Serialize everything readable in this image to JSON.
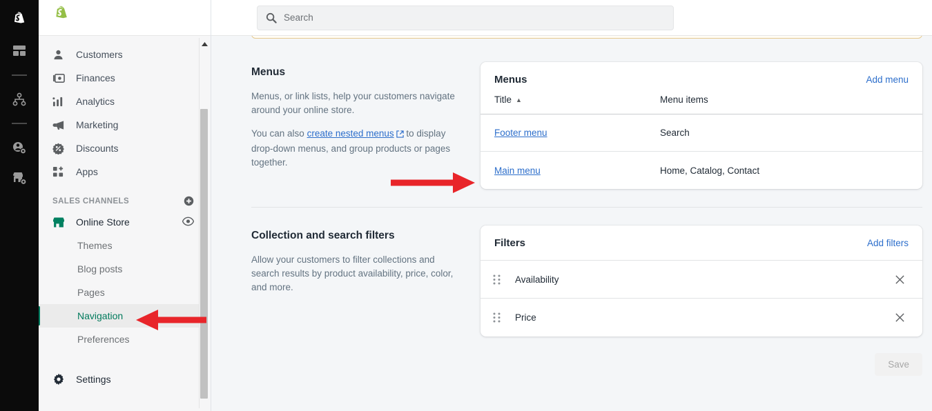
{
  "app": {
    "logo_icon": "shopify-bag-logo",
    "rail_items": [
      {
        "icon": "shopify-bag-logo",
        "name": "shopify-logo"
      },
      {
        "icon": "dashboard-grid-icon",
        "name": "dashboard"
      },
      {
        "icon": "divider",
        "name": "divider-1"
      },
      {
        "icon": "sitemap-hierarchy-icon",
        "name": "organization"
      },
      {
        "icon": "divider",
        "name": "divider-2"
      },
      {
        "icon": "user-settings-icon",
        "name": "user-settings"
      },
      {
        "icon": "store-settings-icon",
        "name": "store-settings"
      }
    ]
  },
  "search": {
    "placeholder": "Search",
    "value": "",
    "icon": "search-icon"
  },
  "sidebar": {
    "nav_items": [
      {
        "label": "Customers",
        "icon": "customers-icon"
      },
      {
        "label": "Finances",
        "icon": "finances-icon"
      },
      {
        "label": "Analytics",
        "icon": "analytics-icon"
      },
      {
        "label": "Marketing",
        "icon": "marketing-megaphone-icon"
      },
      {
        "label": "Discounts",
        "icon": "discounts-tag-icon"
      },
      {
        "label": "Apps",
        "icon": "apps-grid-plus-icon"
      }
    ],
    "sales_channels_label": "SALES CHANNELS",
    "add_channel_icon": "plus-circle-icon",
    "online_store": {
      "label": "Online Store",
      "icon": "storefront-icon",
      "icon_color": "#008060",
      "view_icon": "eye-icon"
    },
    "sub_items": [
      {
        "label": "Themes",
        "active": false
      },
      {
        "label": "Blog posts",
        "active": false
      },
      {
        "label": "Pages",
        "active": false
      },
      {
        "label": "Navigation",
        "active": true
      },
      {
        "label": "Preferences",
        "active": false
      }
    ],
    "settings": {
      "label": "Settings",
      "icon": "gear-icon"
    },
    "active_accent_color": "#00795c",
    "scrollbar": {
      "up_arrow_icon": "caret-up-icon"
    }
  },
  "main": {
    "menus_section": {
      "title": "Menus",
      "paragraph_1": "Menus, or link lists, help your customers navigate around your online store.",
      "paragraph_2_before": "You can also ",
      "link_text": "create nested menus",
      "link_icon": "external-link-icon",
      "paragraph_2_after": " to display drop-down menus, and group products or pages together.",
      "card": {
        "title": "Menus",
        "action_label": "Add menu",
        "columns": [
          "Title",
          "Menu items"
        ],
        "sort_indicator": "▲",
        "rows": [
          {
            "title": "Footer menu",
            "items": "Search"
          },
          {
            "title": "Main menu",
            "items": "Home, Catalog, Contact"
          }
        ]
      }
    },
    "filters_section": {
      "title": "Collection and search filters",
      "paragraph": "Allow your customers to filter collections and search results by product availability, price, color, and more.",
      "card": {
        "title": "Filters",
        "action_label": "Add filters",
        "rows": [
          {
            "name": "Availability",
            "grip_icon": "drag-handle-icon",
            "remove_icon": "close-icon"
          },
          {
            "name": "Price",
            "grip_icon": "drag-handle-icon",
            "remove_icon": "close-icon"
          }
        ]
      }
    },
    "save_label": "Save",
    "save_disabled": true
  },
  "annotations": {
    "arrow_color": "#e8252a",
    "arrows": [
      {
        "name": "arrow-to-navigation",
        "points_to": "Navigation"
      },
      {
        "name": "arrow-to-main-menu",
        "points_to": "Main menu"
      }
    ]
  }
}
